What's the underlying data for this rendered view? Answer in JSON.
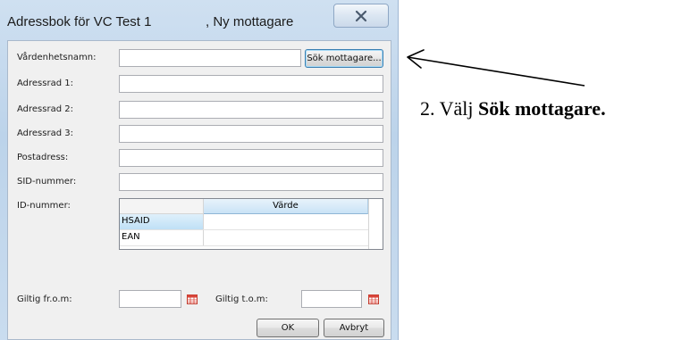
{
  "window": {
    "title_prefix": "Adressbok för VC Test 1",
    "title_suffix": ", Ny mottagare"
  },
  "form": {
    "labels": {
      "vardenhetsnamn": "Vårdenhetsnamn:",
      "adressrad1": "Adressrad 1:",
      "adressrad2": "Adressrad 2:",
      "adressrad3": "Adressrad 3:",
      "postadress": "Postadress:",
      "sid": "SID-nummer:",
      "id": "ID-nummer:",
      "giltig_from": "Giltig fr.o.m:",
      "giltig_tom": "Giltig t.o.m:"
    },
    "values": {
      "vardenhetsnamn": "",
      "adressrad1": "",
      "adressrad2": "",
      "adressrad3": "",
      "postadress": "",
      "sid": "",
      "giltig_from": "",
      "giltig_tom": ""
    },
    "search_button": "Sök mottagare...",
    "id_grid": {
      "column_header": "Värde",
      "rows": [
        {
          "type": "HSAID",
          "value": ""
        },
        {
          "type": "EAN",
          "value": ""
        }
      ]
    },
    "ok_button": "OK",
    "cancel_button": "Avbryt"
  },
  "annotation": {
    "prefix": "2. Välj ",
    "bold": "Sök mottagare."
  },
  "icons": {
    "close": "close-icon",
    "calendar": "calendar-icon",
    "arrow": "arrow-left-icon"
  }
}
